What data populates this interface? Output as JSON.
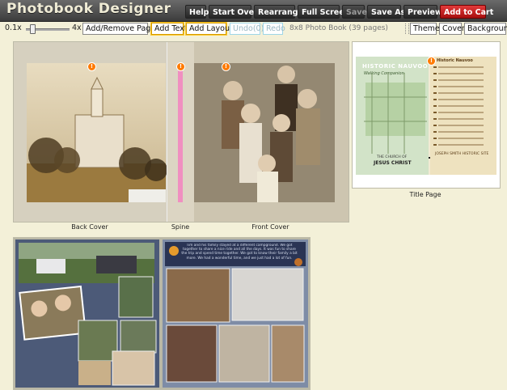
{
  "header": {
    "app_title": "Photobook Designer",
    "buttons": {
      "help": "Help",
      "start_over": "Start Over",
      "rearrange": "Rearrange",
      "full_screen": "Full Screen",
      "save": "Save",
      "save_as": "Save As",
      "preview": "Preview",
      "add_to_cart": "Add to Cart"
    }
  },
  "toolbar": {
    "zoom_min": "0.1x",
    "zoom_max": "4x",
    "add_remove_pages": "Add/Remove Pages",
    "add_text": "Add Text",
    "add_layout": "Add Layout",
    "undo": "Undo(0)",
    "redo": "Redo",
    "book_info": "8x8 Photo Book (39 pages)",
    "theme": "Theme",
    "cover": "Cover",
    "background": "Background"
  },
  "spreads": {
    "back_cover": "Back Cover",
    "spine": "Spine",
    "front_cover": "Front Cover",
    "title_page": "Title Page"
  },
  "map_page": {
    "map_title": "HISTORIC NAUVOO",
    "map_subtitle": "Walking Companion",
    "legend_title": "Historic Nauvoo",
    "church_line1": "THE CHURCH OF",
    "church_line2": "JESUS CHRIST",
    "footer": "JOSEPH SMITH HISTORIC SITE"
  },
  "inner_page": {
    "intro_text": "Tim and his family stayed at a different campground. We got together to share a nice ride and all the days. It was fun to share the trip and spend time together. We got to know their family a bit more. We had a wonderful time, and we just had a lot of fun."
  },
  "colors": {
    "accent_red": "#c41a1a",
    "spine_pink": "#f08fc0",
    "warning_orange": "#ff7a00"
  }
}
